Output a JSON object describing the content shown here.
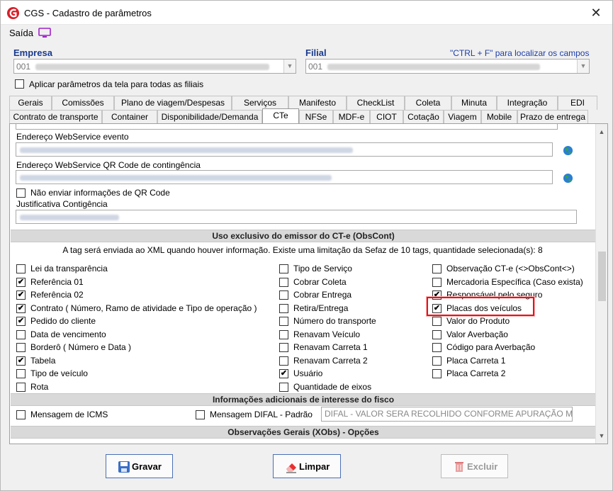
{
  "window": {
    "title": "CGS - Cadastro de parâmetros",
    "close_glyph": "✕",
    "menu_saida": "Saída"
  },
  "header": {
    "empresa_label": "Empresa",
    "empresa_value": "001",
    "filial_label": "Filial",
    "filial_value": "001",
    "hint": "\"CTRL + F\" para localizar os campos",
    "apply_all_label": "Aplicar parâmetros da tela para todas as filiais",
    "apply_all_checked": false
  },
  "tabs_row1": [
    "Gerais",
    "Comissões",
    "Plano de viagem/Despesas",
    "Serviços",
    "Manifesto",
    "CheckList",
    "Coleta",
    "Minuta",
    "Integração",
    "EDI"
  ],
  "tabs_row2": [
    "Contrato de transporte",
    "Container",
    "Disponibilidade/Demanda",
    "CTe",
    "NFSe",
    "MDF-e",
    "CIOT",
    "Cotação",
    "Viagem",
    "Mobile",
    "Prazo de entrega"
  ],
  "active_tab": "CTe",
  "panel": {
    "ws_evento_label": "Endereço WebService evento",
    "ws_qrcode_label": "Endereço WebService QR Code de contingência",
    "no_qrcode_label": "Não enviar informações de QR Code",
    "justificativa_label": "Justificativa Contigência",
    "section_obscont": "Uso exclusivo do emissor do CT-e (ObsCont)",
    "info_text": "A tag será enviada ao XML quando houver informação. Existe uma limitação da Sefaz de 10 tags, quantidade selecionada(s): 8",
    "col1": [
      {
        "label": "Lei da transparência",
        "checked": false
      },
      {
        "label": "Referência 01",
        "checked": true
      },
      {
        "label": "Referência 02",
        "checked": true
      },
      {
        "label": "Contrato ( Número, Ramo de atividade e Tipo de operação )",
        "checked": true
      },
      {
        "label": "Pedido do cliente",
        "checked": true
      },
      {
        "label": "Data de vencimento",
        "checked": false
      },
      {
        "label": "Borderô ( Número e Data )",
        "checked": false
      },
      {
        "label": "Tabela",
        "checked": true
      },
      {
        "label": "Tipo de veículo",
        "checked": false
      },
      {
        "label": "Rota",
        "checked": false
      }
    ],
    "col2": [
      {
        "label": "Tipo de Serviço",
        "checked": false
      },
      {
        "label": "Cobrar Coleta",
        "checked": false
      },
      {
        "label": "Cobrar Entrega",
        "checked": false
      },
      {
        "label": "Retira/Entrega",
        "checked": false
      },
      {
        "label": "Número do transporte",
        "checked": false
      },
      {
        "label": "Renavam Veículo",
        "checked": false
      },
      {
        "label": "Renavam Carreta 1",
        "checked": false
      },
      {
        "label": "Renavam Carreta 2",
        "checked": false
      },
      {
        "label": "Usuário",
        "checked": true
      },
      {
        "label": "Quantidade de eixos",
        "checked": false
      }
    ],
    "col3": [
      {
        "label": "Observação CT-e (<>ObsCont<>)",
        "checked": false
      },
      {
        "label": "Mercadoria Específica (Caso exista)",
        "checked": false
      },
      {
        "label": "Responsável pelo seguro",
        "checked": true
      },
      {
        "label": "Placas dos veículos",
        "checked": true
      },
      {
        "label": "Valor do Produto",
        "checked": false
      },
      {
        "label": "Valor Averbação",
        "checked": false
      },
      {
        "label": "Código para Averbação",
        "checked": false
      },
      {
        "label": "Placa Carreta 1",
        "checked": false
      },
      {
        "label": "Placa Carreta 2",
        "checked": false
      }
    ],
    "section_fisco": "Informações adicionais de interesse do fisco",
    "msg_icms_label": "Mensagem de ICMS",
    "msg_difal_label": "Mensagem DIFAL - Padrão",
    "difal_value": "DIFAL - VALOR SERA RECOLHIDO CONFORME APURAÇÃO M",
    "section_xobs": "Observações Gerais (XObs) - Opções"
  },
  "buttons": {
    "gravar": "Gravar",
    "limpar": "Limpar",
    "excluir": "Excluir"
  },
  "colors": {
    "highlight": "#e0141e",
    "label_blue": "#1a3a8f",
    "logo_red": "#d6202a"
  },
  "icons": {
    "logo": "app-logo-icon",
    "saida": "monitor-icon",
    "globe": "globe-icon",
    "gravar": "save-icon",
    "limpar": "eraser-icon",
    "excluir": "trash-icon"
  }
}
